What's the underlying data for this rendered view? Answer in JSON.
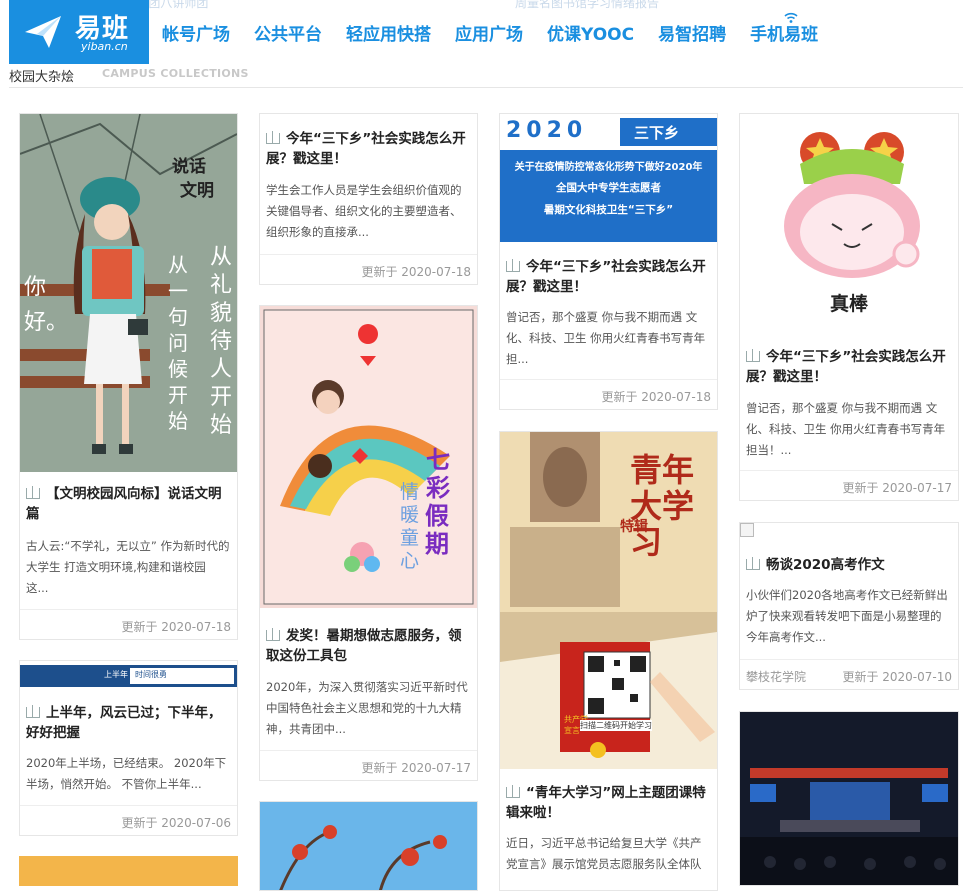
{
  "logo": {
    "cn": "易班",
    "en": "yiban.cn"
  },
  "nav": [
    "帐号广场",
    "公共平台",
    "轻应用快搭",
    "应用广场",
    "优课YOOC",
    "易智招聘",
    "手机易班"
  ],
  "ghost": [
    "“青年大学习”暨九集团八讲师团",
    "周量名图书馆学习情绪报告"
  ],
  "section": {
    "title": "校园大杂烩",
    "sub": "CAMPUS COLLECTIONS"
  },
  "cards": {
    "c1": {
      "img_text": [
        "说话",
        "文明",
        "你",
        "好。",
        "从一句问候开始",
        "从礼貌待人开始"
      ],
      "title": "【文明校园风向标】说话文明篇",
      "desc": "古人云:“不学礼，无以立” 作为新时代的大学生 打造文明环境,构建和谐校园 这...",
      "date": "更新于 2020-07-18"
    },
    "c2": {
      "banner": [
        "上半年",
        "时间很勇"
      ],
      "title": "上半年，风云已过；下半年，好好把握",
      "desc": "2020年上半场，已经结束。 2020年下半场，悄然开始。 不管你上半年...",
      "date": "更新于 2020-07-06"
    },
    "c3": {
      "title": "今年“三下乡”社会实践怎么开展？戳这里！",
      "desc": "学生会工作人员是学生会组织价值观的关键倡导者、组织文化的主要塑造者、组织形象的直接承...",
      "date": "更新于 2020-07-18"
    },
    "c4": {
      "img_text": [
        "七彩",
        "假期",
        "情暖童心"
      ],
      "title": "发奖！暑期想做志愿服务，领取这份工具包",
      "desc": "2020年，为深入贯彻落实习近平新时代中国特色社会主义思想和党的十九大精神，共青团中...",
      "date": "更新于 2020-07-17"
    },
    "c5": {
      "img_text": [
        "2020",
        "三下乡",
        "关于在疫情防控常态化形势下做好2020年",
        "全国大中专学生志愿者",
        "暑期文化科技卫生“三下乡”"
      ],
      "title": "今年“三下乡”社会实践怎么开展？戳这里！",
      "desc": "曾记否，那个盛夏 你与我不期而遇 文化、科技、卫生 你用火红青春书写青年担...",
      "date": "更新于 2020-07-18"
    },
    "c6": {
      "img_text": [
        "青年大学习",
        "特辑",
        "共产党宣言",
        "扫描二维码开始学习"
      ],
      "title": "“青年大学习”网上主题团课特辑来啦！",
      "desc": "近日，习近平总书记给复旦大学《共产党宣言》展示馆党员志愿服务队全体队"
    },
    "c7": {
      "img_text": [
        "真棒"
      ],
      "title": "今年“三下乡”社会实践怎么开展？戳这里！",
      "desc": "曾记否，那个盛夏 你与我不期而遇 文化、科技、卫生 你用火红青春书写青年担当！...",
      "date": "更新于 2020-07-17"
    },
    "c8": {
      "title": "畅谈2020高考作文",
      "desc": "小伙伴们2020各地高考作文已经新鲜出炉了快来观看转发吧下面是小易整理的今年高考作文...",
      "source": "攀枝花学院",
      "date": "更新于 2020-07-10"
    }
  },
  "colors": {
    "brand": "#1a8fe0",
    "nav": "#1a8fe0"
  }
}
